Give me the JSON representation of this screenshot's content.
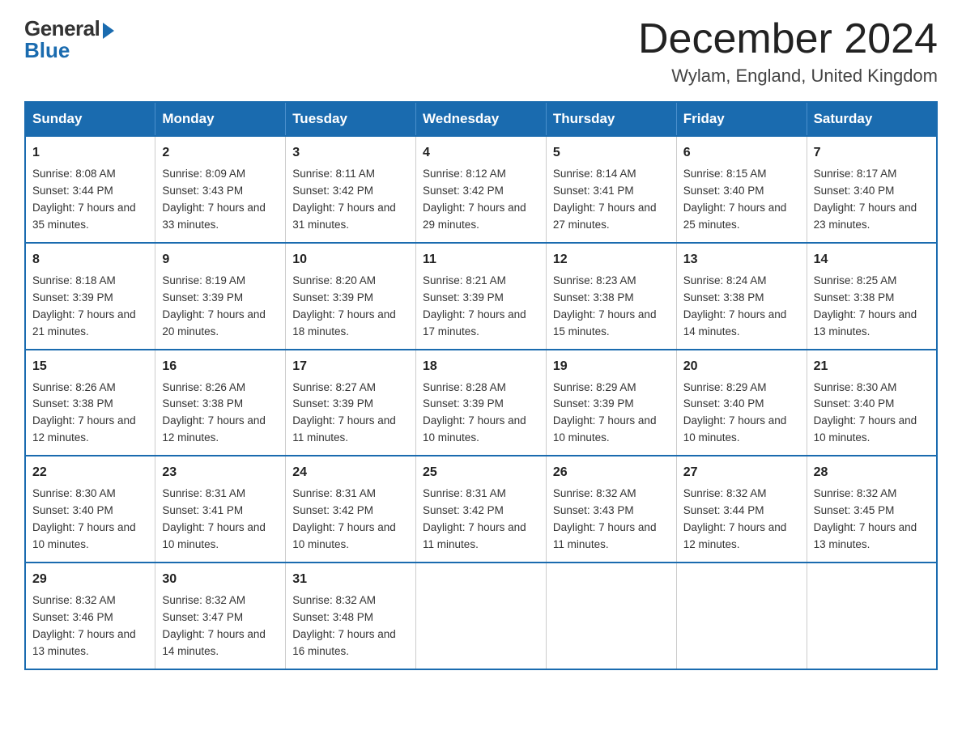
{
  "logo": {
    "general": "General",
    "blue": "Blue"
  },
  "header": {
    "title": "December 2024",
    "location": "Wylam, England, United Kingdom"
  },
  "weekdays": [
    "Sunday",
    "Monday",
    "Tuesday",
    "Wednesday",
    "Thursday",
    "Friday",
    "Saturday"
  ],
  "weeks": [
    [
      {
        "day": "1",
        "sunrise": "8:08 AM",
        "sunset": "3:44 PM",
        "daylight": "7 hours and 35 minutes."
      },
      {
        "day": "2",
        "sunrise": "8:09 AM",
        "sunset": "3:43 PM",
        "daylight": "7 hours and 33 minutes."
      },
      {
        "day": "3",
        "sunrise": "8:11 AM",
        "sunset": "3:42 PM",
        "daylight": "7 hours and 31 minutes."
      },
      {
        "day": "4",
        "sunrise": "8:12 AM",
        "sunset": "3:42 PM",
        "daylight": "7 hours and 29 minutes."
      },
      {
        "day": "5",
        "sunrise": "8:14 AM",
        "sunset": "3:41 PM",
        "daylight": "7 hours and 27 minutes."
      },
      {
        "day": "6",
        "sunrise": "8:15 AM",
        "sunset": "3:40 PM",
        "daylight": "7 hours and 25 minutes."
      },
      {
        "day": "7",
        "sunrise": "8:17 AM",
        "sunset": "3:40 PM",
        "daylight": "7 hours and 23 minutes."
      }
    ],
    [
      {
        "day": "8",
        "sunrise": "8:18 AM",
        "sunset": "3:39 PM",
        "daylight": "7 hours and 21 minutes."
      },
      {
        "day": "9",
        "sunrise": "8:19 AM",
        "sunset": "3:39 PM",
        "daylight": "7 hours and 20 minutes."
      },
      {
        "day": "10",
        "sunrise": "8:20 AM",
        "sunset": "3:39 PM",
        "daylight": "7 hours and 18 minutes."
      },
      {
        "day": "11",
        "sunrise": "8:21 AM",
        "sunset": "3:39 PM",
        "daylight": "7 hours and 17 minutes."
      },
      {
        "day": "12",
        "sunrise": "8:23 AM",
        "sunset": "3:38 PM",
        "daylight": "7 hours and 15 minutes."
      },
      {
        "day": "13",
        "sunrise": "8:24 AM",
        "sunset": "3:38 PM",
        "daylight": "7 hours and 14 minutes."
      },
      {
        "day": "14",
        "sunrise": "8:25 AM",
        "sunset": "3:38 PM",
        "daylight": "7 hours and 13 minutes."
      }
    ],
    [
      {
        "day": "15",
        "sunrise": "8:26 AM",
        "sunset": "3:38 PM",
        "daylight": "7 hours and 12 minutes."
      },
      {
        "day": "16",
        "sunrise": "8:26 AM",
        "sunset": "3:38 PM",
        "daylight": "7 hours and 12 minutes."
      },
      {
        "day": "17",
        "sunrise": "8:27 AM",
        "sunset": "3:39 PM",
        "daylight": "7 hours and 11 minutes."
      },
      {
        "day": "18",
        "sunrise": "8:28 AM",
        "sunset": "3:39 PM",
        "daylight": "7 hours and 10 minutes."
      },
      {
        "day": "19",
        "sunrise": "8:29 AM",
        "sunset": "3:39 PM",
        "daylight": "7 hours and 10 minutes."
      },
      {
        "day": "20",
        "sunrise": "8:29 AM",
        "sunset": "3:40 PM",
        "daylight": "7 hours and 10 minutes."
      },
      {
        "day": "21",
        "sunrise": "8:30 AM",
        "sunset": "3:40 PM",
        "daylight": "7 hours and 10 minutes."
      }
    ],
    [
      {
        "day": "22",
        "sunrise": "8:30 AM",
        "sunset": "3:40 PM",
        "daylight": "7 hours and 10 minutes."
      },
      {
        "day": "23",
        "sunrise": "8:31 AM",
        "sunset": "3:41 PM",
        "daylight": "7 hours and 10 minutes."
      },
      {
        "day": "24",
        "sunrise": "8:31 AM",
        "sunset": "3:42 PM",
        "daylight": "7 hours and 10 minutes."
      },
      {
        "day": "25",
        "sunrise": "8:31 AM",
        "sunset": "3:42 PM",
        "daylight": "7 hours and 11 minutes."
      },
      {
        "day": "26",
        "sunrise": "8:32 AM",
        "sunset": "3:43 PM",
        "daylight": "7 hours and 11 minutes."
      },
      {
        "day": "27",
        "sunrise": "8:32 AM",
        "sunset": "3:44 PM",
        "daylight": "7 hours and 12 minutes."
      },
      {
        "day": "28",
        "sunrise": "8:32 AM",
        "sunset": "3:45 PM",
        "daylight": "7 hours and 13 minutes."
      }
    ],
    [
      {
        "day": "29",
        "sunrise": "8:32 AM",
        "sunset": "3:46 PM",
        "daylight": "7 hours and 13 minutes."
      },
      {
        "day": "30",
        "sunrise": "8:32 AM",
        "sunset": "3:47 PM",
        "daylight": "7 hours and 14 minutes."
      },
      {
        "day": "31",
        "sunrise": "8:32 AM",
        "sunset": "3:48 PM",
        "daylight": "7 hours and 16 minutes."
      },
      null,
      null,
      null,
      null
    ]
  ]
}
